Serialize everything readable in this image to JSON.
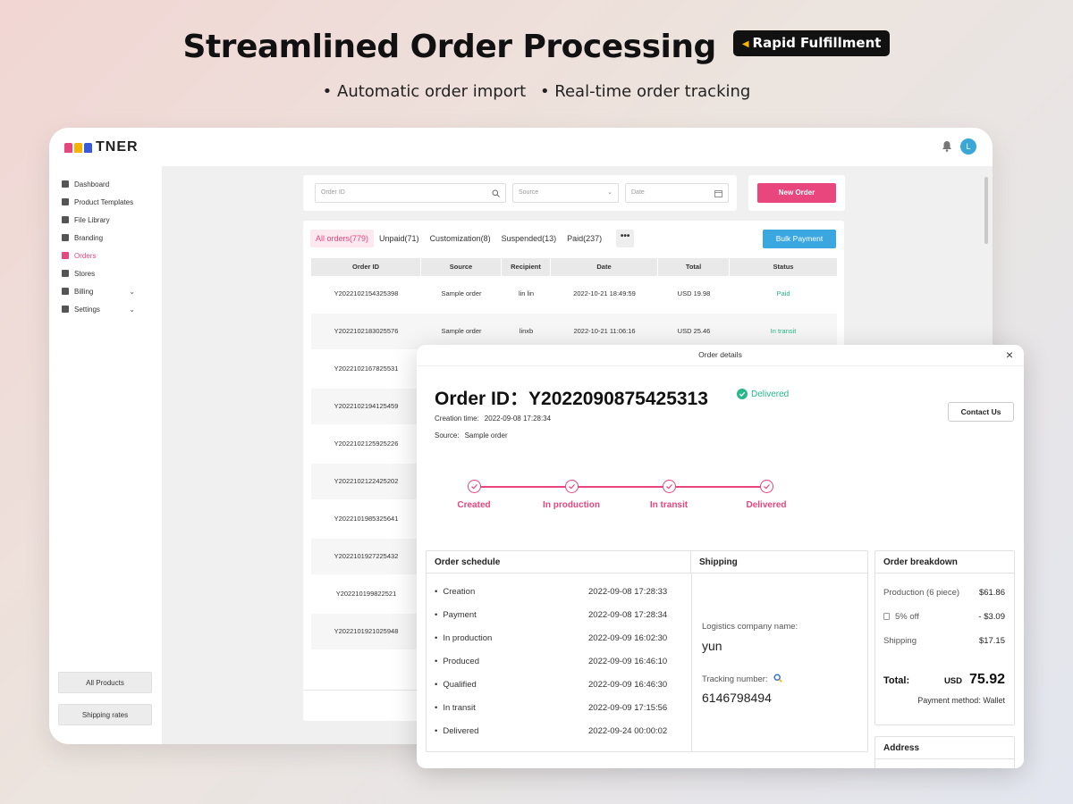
{
  "hero": {
    "title": "Streamlined Order Processing",
    "badge": "Rapid Fulfillment",
    "bullets": [
      "• Automatic order import",
      "• Real-time order tracking"
    ]
  },
  "app": {
    "logo_text": "TNER",
    "avatar_letter": "L",
    "sidebar": {
      "items": [
        {
          "label": "Dashboard",
          "icon": "home-icon"
        },
        {
          "label": "Product Templates",
          "icon": "shirt-icon"
        },
        {
          "label": "File Library",
          "icon": "layers-icon"
        },
        {
          "label": "Branding",
          "icon": "gem-icon"
        },
        {
          "label": "Orders",
          "icon": "clipboard-icon",
          "active": true
        },
        {
          "label": "Stores",
          "icon": "store-icon"
        },
        {
          "label": "Billing",
          "icon": "card-icon",
          "expandable": true
        },
        {
          "label": "Settings",
          "icon": "gear-icon",
          "expandable": true
        }
      ],
      "bottom_buttons": [
        "All Products",
        "Shipping rates"
      ]
    },
    "filters": {
      "order_id_placeholder": "Order ID",
      "source_placeholder": "Source",
      "date_placeholder": "Date"
    },
    "new_order_label": "New Order",
    "tabs": [
      "All orders(779)",
      "Unpaid(71)",
      "Customization(8)",
      "Suspended(13)",
      "Paid(237)"
    ],
    "more_label": "•••",
    "bulk_payment_label": "Bulk Payment",
    "table": {
      "columns": [
        "Order ID",
        "Source",
        "Recipient",
        "Date",
        "Total",
        "Status"
      ],
      "rows": [
        {
          "id": "Y2022102154325398",
          "source": "Sample order",
          "recipient": "lin lin",
          "date": "2022-10-21 18:49:59",
          "total": "USD 19.98",
          "status": "Paid"
        },
        {
          "id": "Y2022102183025576",
          "source": "Sample order",
          "recipient": "linxb",
          "date": "2022-10-21 11:06:16",
          "total": "USD 25.46",
          "status": "In transit"
        },
        {
          "id": "Y2022102167825531"
        },
        {
          "id": "Y2022102194125459"
        },
        {
          "id": "Y2022102125925226"
        },
        {
          "id": "Y2022102122425202"
        },
        {
          "id": "Y2022101985325641"
        },
        {
          "id": "Y2022101927225432"
        },
        {
          "id": "Y202210199822521"
        },
        {
          "id": "Y2022101921025948"
        }
      ]
    }
  },
  "modal": {
    "title": "Order details",
    "order_id_label": "Order ID：",
    "order_id": "Y2022090875425313",
    "status": "Delivered",
    "creation_time_label": "Creation time:",
    "creation_time": "2022-09-08 17:28:34",
    "source_label": "Source:",
    "source": "Sample order",
    "contact_label": "Contact Us",
    "steps": [
      "Created",
      "In production",
      "In transit",
      "Delivered"
    ],
    "schedule": {
      "title": "Order schedule",
      "rows": [
        {
          "label": "Creation",
          "time": "2022-09-08 17:28:33"
        },
        {
          "label": "Payment",
          "time": "2022-09-08 17:28:34"
        },
        {
          "label": "In production",
          "time": "2022-09-09 16:02:30"
        },
        {
          "label": "Produced",
          "time": "2022-09-09 16:46:10"
        },
        {
          "label": "Qualified",
          "time": "2022-09-09 16:46:30"
        },
        {
          "label": "In transit",
          "time": "2022-09-09 17:15:56"
        },
        {
          "label": "Delivered",
          "time": "2022-09-24 00:00:02"
        }
      ]
    },
    "shipping": {
      "title": "Shipping",
      "logistics_label": "Logistics company name:",
      "logistics_value": "yun",
      "tracking_label": "Tracking number:",
      "tracking_value": "6146798494"
    },
    "breakdown": {
      "title": "Order breakdown",
      "production_label": "Production (6 piece)",
      "production_value": "$61.86",
      "discount_label": "5% off",
      "discount_value": "- $3.09",
      "shipping_label": "Shipping",
      "shipping_value": "$17.15",
      "total_label": "Total:",
      "total_currency": "USD",
      "total_value": "75.92",
      "payment_method": "Payment method: Wallet"
    },
    "address_title": "Address"
  },
  "colors": {
    "accent": "#e8467c",
    "success": "#26b88a",
    "info": "#3aa7e0"
  }
}
